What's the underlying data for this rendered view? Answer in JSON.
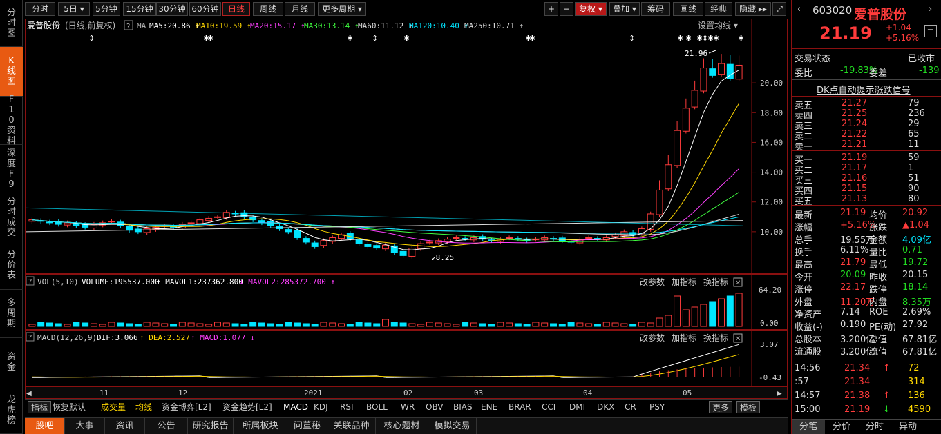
{
  "leftnav": [
    "分时图",
    "K线图",
    "F10资料",
    "深度F9",
    "分时成交",
    "分价表",
    "多周期",
    "资金",
    "龙虎榜"
  ],
  "toolbar": {
    "items": [
      "分时",
      "5日",
      "5分钟",
      "15分钟",
      "30分钟",
      "60分钟",
      "日线",
      "周线",
      "月线",
      "更多周期"
    ],
    "right": [
      "复权",
      "叠加",
      "筹码",
      "画线",
      "经典",
      "隐藏"
    ]
  },
  "chart": {
    "title": "爱普股份",
    "subtitle": "(日线,前复权)",
    "ma_label": "MA",
    "ma": [
      {
        "t": "MA5:20.86",
        "c": "#ffffff"
      },
      {
        "t": "MA10:19.59",
        "c": "#ffd700"
      },
      {
        "t": "MA20:15.17",
        "c": "#ff40ff"
      },
      {
        "t": "MA30:13.14",
        "c": "#40ff40"
      },
      {
        "t": "MA60:11.12",
        "c": "#dddddd"
      },
      {
        "t": "MA120:10.40",
        "c": "#00e5ff"
      },
      {
        "t": "MA250:10.71",
        "c": "#dddddd"
      }
    ],
    "settings": "设置均线",
    "yticks": [
      "20.00",
      "18.00",
      "16.00",
      "14.00",
      "12.00",
      "10.00"
    ],
    "yvals": [
      20,
      18,
      16,
      14,
      12,
      10
    ],
    "xticks": [
      "11",
      "12",
      "2021",
      "02",
      "03",
      "04",
      "05"
    ],
    "high_mark": "21.96",
    "low_mark": "8.25",
    "vol": {
      "label": "VOL(5,10)",
      "volume": "VOLUME:195537.000",
      "m1": "MAVOL1:237362.800",
      "m2": "MAVOL2:285372.700",
      "top": "64.20",
      "bot": "0.00"
    },
    "macd": {
      "label": "MACD(12,26,9)",
      "dif": "DIF:3.066",
      "dea": "DEA:2.527",
      "macd": "MACD:1.077",
      "top": "3.07",
      "bot": "-0.43"
    },
    "pane_tools": [
      "改参数",
      "加指标",
      "换指标"
    ]
  },
  "indicator_tabs": [
    "指标",
    "恢复默认",
    "成交量",
    "均线",
    "资金博弈[L2]",
    "资金趋势[L2]",
    "MACD",
    "KDJ",
    "RSI",
    "BOLL",
    "WR",
    "OBV",
    "BIAS",
    "ENE",
    "BRAR",
    "CCI",
    "DMI",
    "DKX",
    "CR",
    "PSY",
    "更多",
    "模板"
  ],
  "bottom_tabs": [
    "股吧",
    "大事",
    "资讯",
    "公告",
    "研究报告",
    "所属板块",
    "问董秘",
    "关联品种",
    "核心题材",
    "模拟交易"
  ],
  "stock": {
    "code": "603020",
    "name": "爱普股份",
    "price": "21.19",
    "change": "+1.04",
    "pct": "+5.16%",
    "status_label": "交易状态",
    "status": "已收市",
    "webi_label": "委比",
    "webi": "-19.83%",
    "weicha_label": "委差",
    "weicha": "-139",
    "signal": "DK点自动提示涨跌信号",
    "asks": [
      [
        "卖五",
        "21.27",
        "79"
      ],
      [
        "卖四",
        "21.25",
        "236"
      ],
      [
        "卖三",
        "21.24",
        "29"
      ],
      [
        "卖二",
        "21.22",
        "65"
      ],
      [
        "卖一",
        "21.21",
        "11"
      ]
    ],
    "bids": [
      [
        "买一",
        "21.19",
        "59"
      ],
      [
        "买二",
        "21.17",
        "1"
      ],
      [
        "买三",
        "21.16",
        "51"
      ],
      [
        "买四",
        "21.15",
        "90"
      ],
      [
        "买五",
        "21.13",
        "80"
      ]
    ],
    "stats": [
      [
        "最新",
        "21.19",
        "red",
        "均价",
        "20.92",
        "red"
      ],
      [
        "涨幅",
        "+5.16%",
        "red",
        "涨跌",
        "▲1.04",
        "red"
      ],
      [
        "总手",
        "19.55万",
        "white",
        "金额",
        "4.09亿",
        "cyan"
      ],
      [
        "换手",
        "6.11%",
        "white",
        "量比",
        "0.71",
        "green"
      ],
      [
        "最高",
        "21.79",
        "red",
        "最低",
        "19.72",
        "green"
      ],
      [
        "今开",
        "20.09",
        "green",
        "昨收",
        "20.15",
        "white"
      ],
      [
        "涨停",
        "22.17",
        "red",
        "跌停",
        "18.14",
        "green"
      ],
      [
        "外盘",
        "11.20万",
        "red",
        "内盘",
        "8.35万",
        "green"
      ],
      [
        "净资产",
        "7.14",
        "white",
        "ROE",
        "2.69%",
        "white"
      ],
      [
        "收益(-)",
        "0.190",
        "white",
        "PE(动)",
        "27.92",
        "white"
      ],
      [
        "总股本",
        "3.200亿",
        "white",
        "总值",
        "67.81亿",
        "white"
      ],
      [
        "流通股",
        "3.200亿",
        "white",
        "流值",
        "67.81亿",
        "white"
      ]
    ],
    "ticks": [
      [
        "14:56",
        "21.34",
        "↑",
        "72"
      ],
      [
        ":57",
        "21.34",
        "",
        "314"
      ],
      [
        "14:57",
        "21.38",
        "↑",
        "136"
      ],
      [
        "15:00",
        "21.19",
        "↓",
        "4590"
      ]
    ],
    "tabs": [
      "分笔",
      "分价",
      "分时",
      "异动"
    ]
  },
  "chart_data": {
    "type": "candlestick",
    "title": "爱普股份",
    "x": [
      "11",
      "12",
      "2021",
      "02",
      "03",
      "04",
      "05"
    ],
    "ylim": [
      8,
      22
    ],
    "closes": [
      10.8,
      10.7,
      10.6,
      10.5,
      10.6,
      10.4,
      10.3,
      10.5,
      10.6,
      10.7,
      10.4,
      10.1,
      10.0,
      10.2,
      10.3,
      10.4,
      10.3,
      10.5,
      10.6,
      10.8,
      10.9,
      11.0,
      11.3,
      11.2,
      11.0,
      10.8,
      10.6,
      10.4,
      10.2,
      10.0,
      9.6,
      9.3,
      9.0,
      9.4,
      9.6,
      9.8,
      9.5,
      9.2,
      9.0,
      8.9,
      9.1,
      8.6,
      8.4,
      8.9,
      9.2,
      9.3,
      9.4,
      9.5,
      9.6,
      9.5,
      9.6,
      9.5,
      9.4,
      9.5,
      9.6,
      9.5,
      9.4,
      9.5,
      9.6,
      9.5,
      9.4,
      9.3,
      9.5,
      9.6,
      9.5,
      9.6,
      9.8,
      10.0,
      9.8,
      10.2,
      11.2,
      12.8,
      14.5,
      16.8,
      18.3,
      19.5,
      21.0,
      20.5,
      21.3,
      20.3,
      21.19
    ]
  }
}
